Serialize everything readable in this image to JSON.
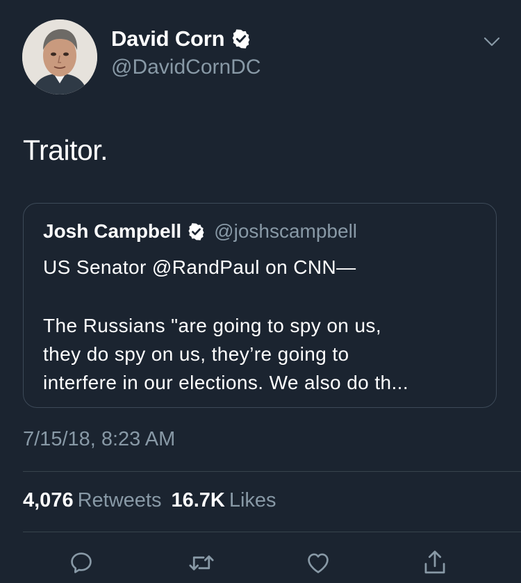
{
  "author": {
    "display_name": "David Corn",
    "handle": "@DavidCornDC",
    "avatar_icon": "profile-photo",
    "verified_icon": "verified-badge-icon"
  },
  "tweet": {
    "text": "Traitor.",
    "timestamp": "7/15/18, 8:23 AM"
  },
  "quoted_tweet": {
    "display_name": "Josh Campbell",
    "handle": "@joshscampbell",
    "lines": [
      "US Senator @RandPaul on CNN—",
      "The Russians \"are going to spy on us,",
      "they do spy on us, they’re going to",
      "interfere in our elections. We also do th..."
    ]
  },
  "stats": {
    "retweets_count": "4,076",
    "retweets_label": "Retweets",
    "likes_count": "16.7K",
    "likes_label": "Likes"
  },
  "actions": [
    "reply-icon",
    "retweet-icon",
    "like-icon",
    "share-icon"
  ],
  "colors": {
    "background": "#1b2430",
    "secondary_text": "#8899a6",
    "border": "#3d4a58"
  }
}
